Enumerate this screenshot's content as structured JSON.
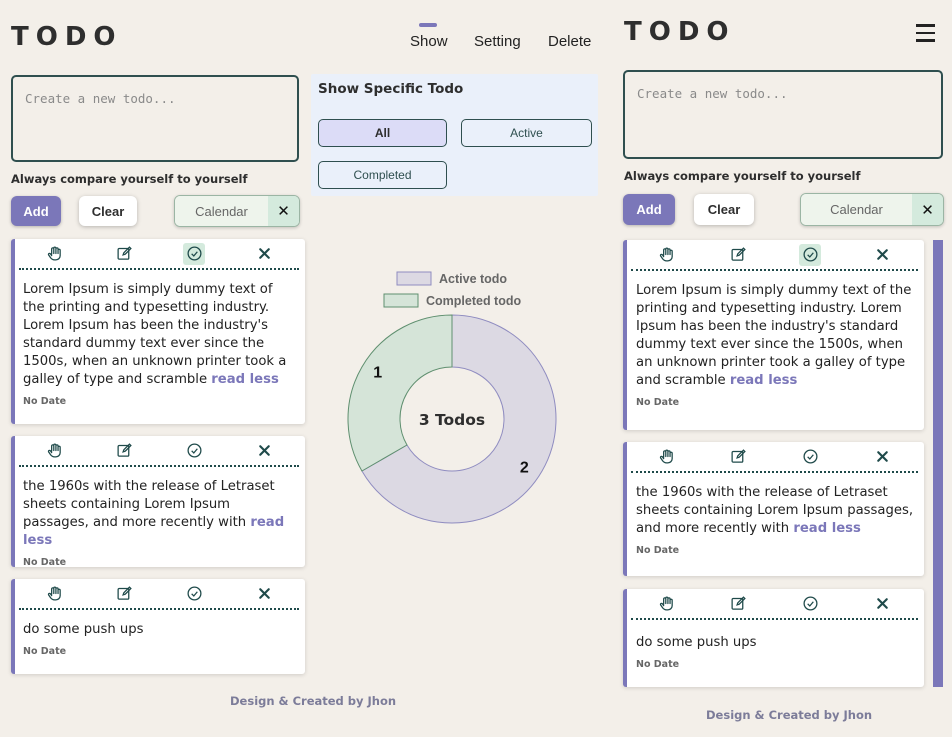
{
  "app": {
    "logo": "TODO"
  },
  "nav": {
    "show": "Show",
    "setting": "Setting",
    "delete": "Delete"
  },
  "composer": {
    "placeholder": "Create a new todo...",
    "motto": "Always compare yourself to yourself",
    "add": "Add",
    "clear": "Clear",
    "calendar": "Calendar",
    "calendar_close": "✕"
  },
  "todos": [
    {
      "text": "Lorem Ipsum is simply dummy text of the printing and typesetting industry. Lorem Ipsum has been the industry's standard dummy text ever since the 1500s, when an unknown printer took a galley of type and scramble",
      "link": "read less",
      "date": "No Date",
      "done": true
    },
    {
      "text": "the 1960s with the release of Letraset sheets containing Lorem Ipsum passages, and more recently with",
      "link": "read less",
      "date": "No Date",
      "done": false
    },
    {
      "text": "do some push ups",
      "link": "",
      "date": "No Date",
      "done": false
    }
  ],
  "filter": {
    "title": "Show Specific Todo",
    "all": "All",
    "active": "Active",
    "completed": "Completed"
  },
  "chart_data": {
    "type": "pie",
    "categories": [
      "Active todo",
      "Completed todo"
    ],
    "values": [
      2,
      1
    ],
    "colors": [
      "#dcd9e3",
      "#d5e4d8"
    ],
    "center_label": "3 Todos"
  },
  "footer": "Design & Created by Jhon",
  "colors": {
    "accent": "#7b77b9",
    "background": "#f3efe9",
    "dark_teal": "#2f4f4f"
  }
}
